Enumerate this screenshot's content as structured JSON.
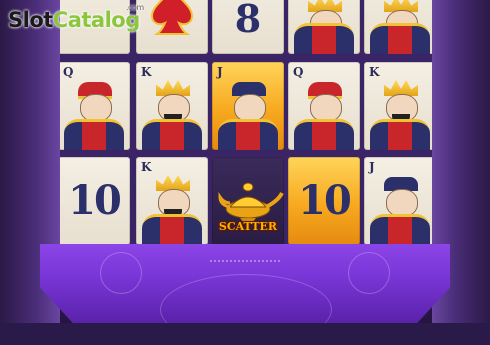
{
  "watermark": {
    "brand_part1": "Slot",
    "brand_part2": "Catalog",
    "brand_suffix": ".com"
  },
  "colors": {
    "accent_gold": "#f7a91f",
    "frame_purple": "#7a36d8",
    "card_navy": "#2b2f6a",
    "card_red": "#c8262b"
  },
  "reels": {
    "row1": [
      {
        "symbol": "spade-card",
        "label": ""
      },
      {
        "symbol": "8-card",
        "label": "8"
      },
      {
        "symbol": "king-card-partial",
        "label": ""
      },
      {
        "symbol": "king-card-partial",
        "label": ""
      }
    ],
    "row2": [
      {
        "symbol": "queen-card",
        "label": "Q"
      },
      {
        "symbol": "king-card",
        "label": "K"
      },
      {
        "symbol": "jack-card",
        "label": "J"
      },
      {
        "symbol": "queen-card",
        "label": "Q"
      },
      {
        "symbol": "king-card",
        "label": "K"
      }
    ],
    "row3": [
      {
        "symbol": "ten-card",
        "label": "10"
      },
      {
        "symbol": "king-card",
        "label": "K"
      },
      {
        "symbol": "scatter-lamp",
        "label": "SCATTER"
      },
      {
        "symbol": "ten-card",
        "label": "10"
      },
      {
        "symbol": "jack-card",
        "label": "J"
      }
    ]
  }
}
